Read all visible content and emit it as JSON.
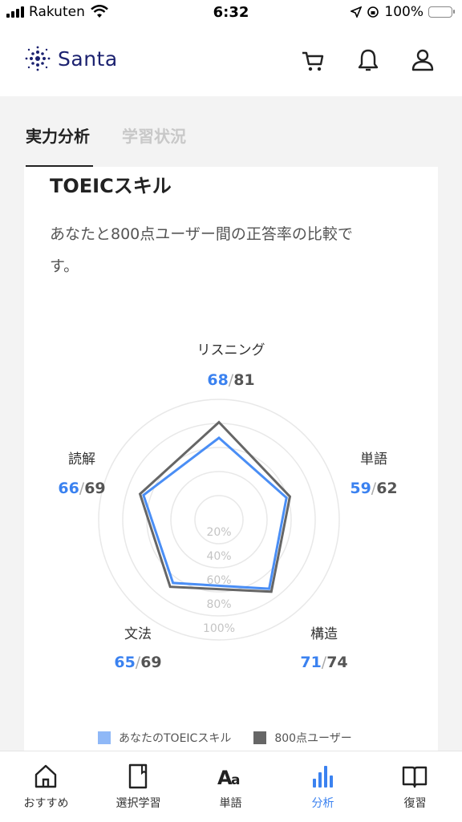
{
  "status_bar": {
    "carrier": "Rakuten",
    "time": "6:32",
    "battery": "100%"
  },
  "header": {
    "logo_text": "Santa",
    "icons": [
      "cart-icon",
      "bell-icon",
      "user-icon"
    ]
  },
  "tabs": [
    {
      "label": "実力分析",
      "active": true
    },
    {
      "label": "学習状況",
      "active": false
    }
  ],
  "card": {
    "title": "TOEICスキル",
    "description": "あなたと800点ユーザー間の正答率の比較です。"
  },
  "chart_data": {
    "type": "radar",
    "axes": [
      "リスニング",
      "単語",
      "構造",
      "文法",
      "読解"
    ],
    "series": [
      {
        "name": "あなたのTOEICスキル",
        "values": [
          68,
          59,
          71,
          65,
          66
        ]
      },
      {
        "name": "800点ユーザー",
        "values": [
          81,
          62,
          74,
          69,
          69
        ]
      }
    ],
    "rings": [
      "20%",
      "40%",
      "60%",
      "80%",
      "100%"
    ],
    "range": [
      0,
      100
    ]
  },
  "skills": [
    {
      "label": "リスニング",
      "mine": "68",
      "ref": "81"
    },
    {
      "label": "単語",
      "mine": "59",
      "ref": "62"
    },
    {
      "label": "構造",
      "mine": "71",
      "ref": "74"
    },
    {
      "label": "文法",
      "mine": "65",
      "ref": "69"
    },
    {
      "label": "読解",
      "mine": "66",
      "ref": "69"
    }
  ],
  "legend": [
    {
      "label": "あなたのTOEICスキル",
      "color": "#8fb8f7"
    },
    {
      "label": "800点ユーザー",
      "color": "#666666"
    }
  ],
  "colors": {
    "accent": "#3b82f0",
    "mine_line": "#4a8ef5",
    "ref_line": "#666666"
  },
  "bottom_nav": [
    {
      "label": "おすすめ",
      "icon": "home-icon",
      "active": false
    },
    {
      "label": "選択学習",
      "icon": "book-page-icon",
      "active": false
    },
    {
      "label": "単語",
      "icon": "text-aa-icon",
      "active": false
    },
    {
      "label": "分析",
      "icon": "bar-chart-icon",
      "active": true
    },
    {
      "label": "復習",
      "icon": "open-book-icon",
      "active": false
    }
  ]
}
